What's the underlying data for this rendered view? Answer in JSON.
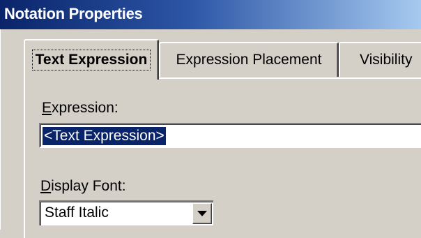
{
  "window": {
    "title": "Notation Properties"
  },
  "tabs": [
    {
      "label": "Text Expression",
      "active": true
    },
    {
      "label": "Expression Placement",
      "active": false
    },
    {
      "label": "Visibility",
      "active": false
    }
  ],
  "expression": {
    "label_underlined": "E",
    "label_rest": "xpression:",
    "value": "<Text Expression>"
  },
  "display_font": {
    "label_underlined": "D",
    "label_rest": "isplay Font:",
    "value": "Staff Italic"
  },
  "colors": {
    "titlebar_start": "#0a246a",
    "titlebar_end": "#a6caf0",
    "dialog_bg": "#d4d0c8",
    "selection": "#0a246a"
  },
  "icons": {
    "dropdown": "chevron-down-icon"
  }
}
